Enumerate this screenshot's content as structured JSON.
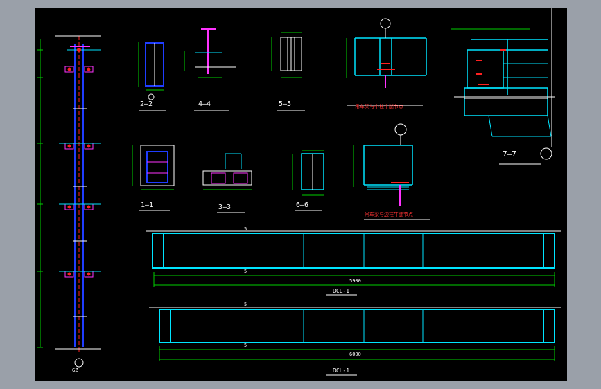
{
  "colors": {
    "background": "#000000",
    "frame": "#9aa0a9",
    "cyan": "#00e5ff",
    "blue": "#1f3dff",
    "red": "#ff2020",
    "magenta": "#ff33ff",
    "green": "#00d000",
    "white": "#ffffff",
    "yellow": "#ffff33"
  },
  "labels": {
    "sec_2_2": "2—2",
    "sec_4_4": "4—4",
    "sec_5_5": "5—5",
    "sec_1_1": "1—1",
    "sec_3_3": "3—3",
    "sec_6_6": "6—6",
    "sec_7_7": "7—7",
    "detail_top": "吊车梁与中柱牛腿节点",
    "detail_mid": "吊车梁与边柱牛腿节点",
    "beam1": "DCL-1",
    "beam2": "DCL-1",
    "dim1": "5900",
    "dim2": "6000",
    "mark_5_a": "5",
    "mark_5_b": "5",
    "mark_5_c": "5",
    "mark_5_d": "5",
    "col_tag": "GZ"
  }
}
